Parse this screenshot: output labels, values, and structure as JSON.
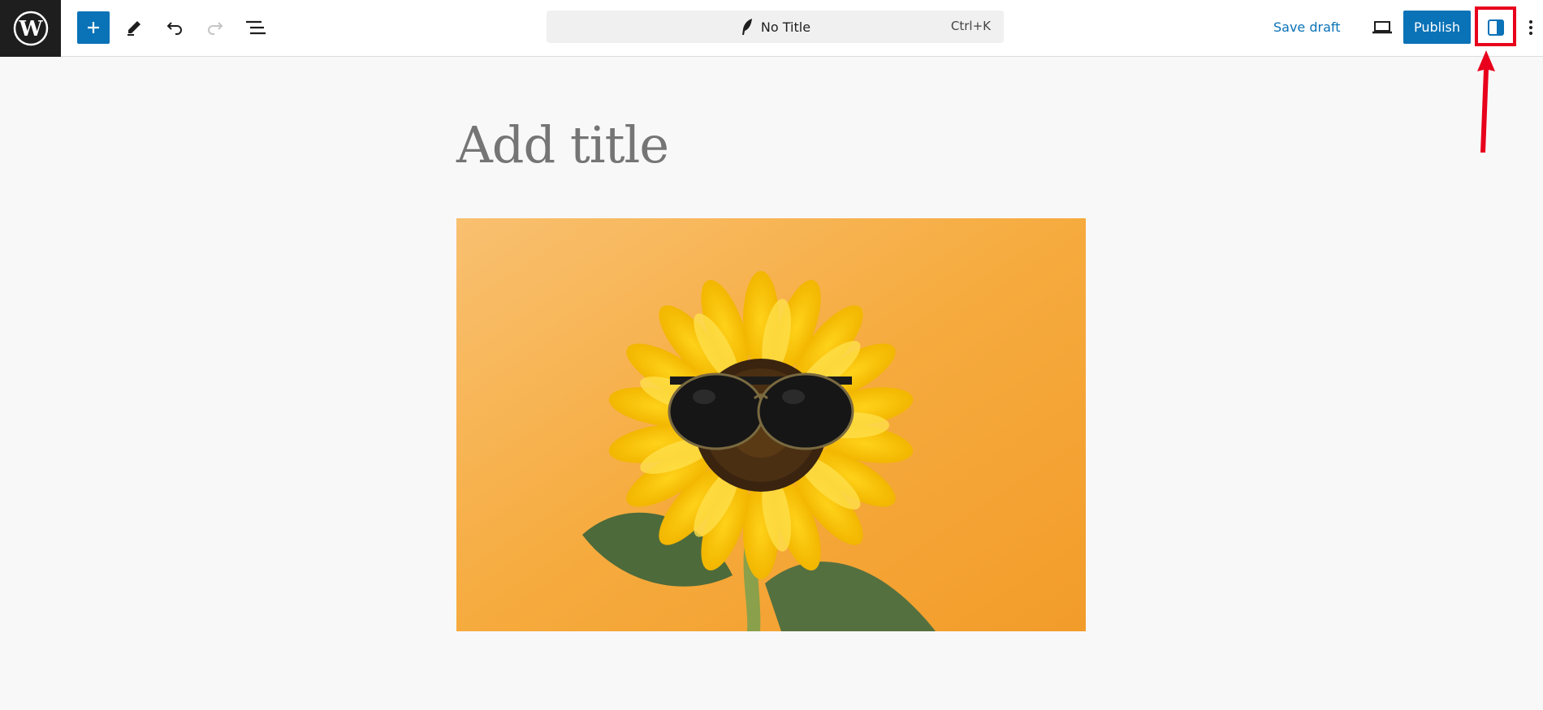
{
  "header": {
    "command_title": "No Title",
    "command_shortcut": "Ctrl+K",
    "save_draft": "Save draft",
    "publish": "Publish"
  },
  "icons": {
    "logo": "wordpress-logo-icon",
    "add": "plus-icon",
    "tools": "pen-icon",
    "undo": "undo-icon",
    "redo": "redo-icon",
    "list_view": "list-view-icon",
    "command": "quill-icon",
    "preview": "laptop-icon",
    "settings": "sidebar-icon",
    "more": "vertical-ellipsis-icon"
  },
  "editor": {
    "title_placeholder": "Add title"
  },
  "colors": {
    "accent": "#0a72b7",
    "highlight": "#e8001c",
    "image_background": "#f6a83a"
  }
}
